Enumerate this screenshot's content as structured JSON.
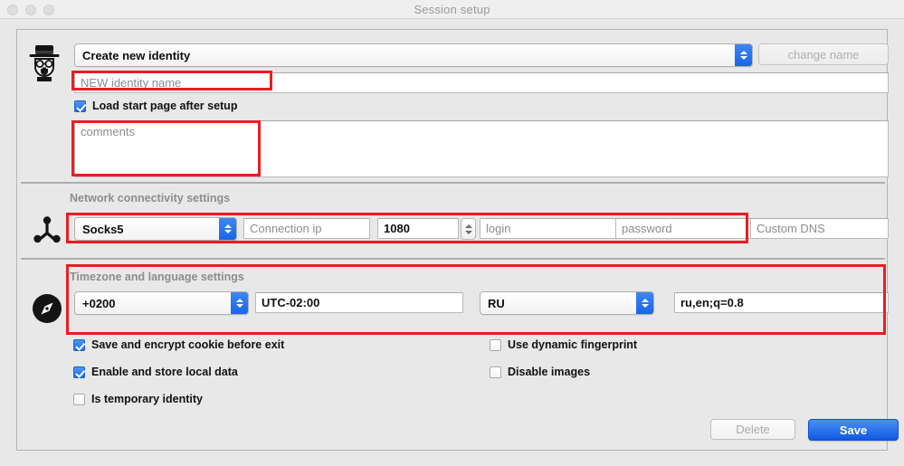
{
  "window": {
    "title": "Session setup",
    "traffic_lights": [
      "close-button",
      "minimize-button",
      "zoom-button"
    ]
  },
  "identity": {
    "icon": "heisenberg-avatar-icon",
    "profile_select": {
      "value": "Create new identity",
      "options": [
        "Create new identity"
      ]
    },
    "change_name_button": "change name",
    "name_field": {
      "placeholder": "NEW identity name",
      "value": ""
    },
    "load_start_page": {
      "label": "Load start page after setup",
      "checked": true
    },
    "comments_field": {
      "placeholder": "comments",
      "value": ""
    }
  },
  "network": {
    "icon": "network-nodes-icon",
    "section_title": "Network connectivity settings",
    "proxy_type": {
      "value": "Socks5",
      "options": [
        "Socks5"
      ]
    },
    "connection_ip": {
      "placeholder": "Connection ip",
      "value": ""
    },
    "port": {
      "value": "1080"
    },
    "login": {
      "placeholder": "login",
      "value": ""
    },
    "password": {
      "placeholder": "password",
      "value": ""
    },
    "custom_dns": {
      "placeholder": "Custom DNS",
      "value": ""
    }
  },
  "locale": {
    "icon": "compass-icon",
    "section_title": "Timezone and language settings",
    "timezone_offset": {
      "value": "+0200",
      "options": [
        "+0200"
      ]
    },
    "utc_label": {
      "value": "UTC-02:00"
    },
    "language": {
      "value": "RU",
      "options": [
        "RU"
      ]
    },
    "accept_language": {
      "value": "ru,en;q=0.8"
    }
  },
  "options": {
    "left": [
      {
        "label": "Save and encrypt cookie before exit",
        "checked": true,
        "name": "save-encrypt-cookie-checkbox"
      },
      {
        "label": "Enable and store local data",
        "checked": true,
        "name": "enable-local-data-checkbox"
      },
      {
        "label": "Is temporary identity",
        "checked": false,
        "name": "temporary-identity-checkbox"
      }
    ],
    "right": [
      {
        "label": "Use dynamic fingerprint",
        "checked": false,
        "name": "dynamic-fingerprint-checkbox"
      },
      {
        "label": "Disable images",
        "checked": false,
        "name": "disable-images-checkbox"
      }
    ]
  },
  "footer": {
    "delete_button": "Delete",
    "save_button": "Save"
  },
  "colors": {
    "accent_blue": "#1866e8",
    "annotation_red": "#ee1b24",
    "window_bg": "#e8e8e8",
    "title_text": "#9a9a9a"
  }
}
